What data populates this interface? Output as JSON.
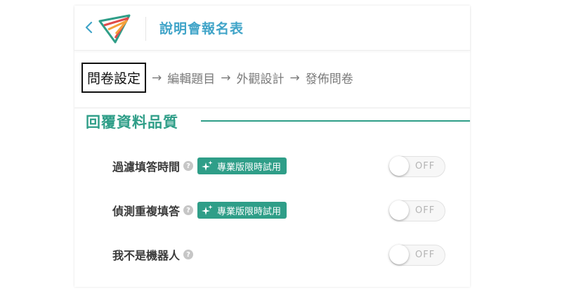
{
  "header": {
    "title": "說明會報名表",
    "back_icon": "chevron-left-icon",
    "logo_icon": "paper-plane-logo"
  },
  "steps": [
    {
      "label": "問卷設定",
      "active": true
    },
    {
      "label": "編輯題目",
      "active": false
    },
    {
      "label": "外觀設計",
      "active": false
    },
    {
      "label": "發佈問卷",
      "active": false
    }
  ],
  "step_arrow": "→",
  "section": {
    "title": "回覆資料品質"
  },
  "pro_badge": "專業版限時試用",
  "help_glyph": "?",
  "settings": [
    {
      "label": "過濾填答時間",
      "pro": true,
      "toggle": "OFF"
    },
    {
      "label": "偵測重複填答",
      "pro": true,
      "toggle": "OFF"
    },
    {
      "label": "我不是機器人",
      "pro": false,
      "toggle": "OFF"
    }
  ],
  "colors": {
    "title": "#40a4c8",
    "accent": "#2f9e88",
    "logo_teal": "#2f9e88",
    "logo_red": "#e04b4b",
    "logo_orange": "#f4a03a"
  }
}
